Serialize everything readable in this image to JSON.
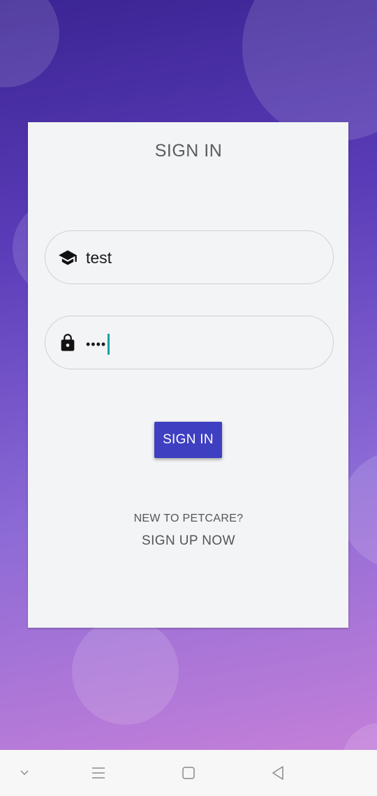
{
  "login": {
    "title": "SIGN IN",
    "username_value": "test",
    "password_mask": "••••",
    "submit_label": "SIGN IN",
    "prompt": "NEW TO PETCARE?",
    "signup_label": "SIGN UP NOW"
  },
  "icons": {
    "username": "graduation-cap-icon",
    "password": "lock-icon"
  },
  "navbar": {
    "items": [
      "chevron-down-icon",
      "menu-icon",
      "home-square-icon",
      "back-triangle-icon"
    ]
  },
  "colors": {
    "button": "#3f3fc2",
    "caret": "#17a2a0",
    "card": "#f3f4f6",
    "gradient_top": "#3b2493",
    "gradient_bottom": "#c37fd8"
  }
}
